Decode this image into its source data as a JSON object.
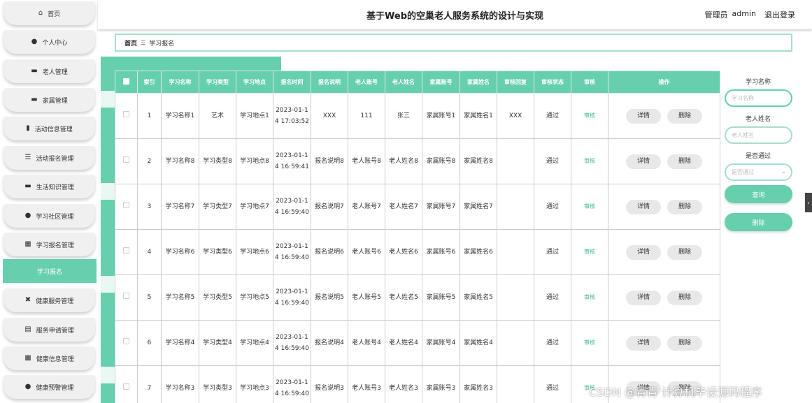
{
  "sidebar": {
    "items": [
      {
        "label": "首页",
        "icon": "home-icon"
      },
      {
        "label": "个人中心",
        "icon": "user-icon"
      },
      {
        "label": "老人管理",
        "icon": "monitor-icon"
      },
      {
        "label": "家属管理",
        "icon": "monitor-icon"
      },
      {
        "label": "活动信息管理",
        "icon": "chart-icon"
      },
      {
        "label": "活动报名管理",
        "icon": "list-icon"
      },
      {
        "label": "生活知识管理",
        "icon": "monitor-icon"
      },
      {
        "label": "学习社区管理",
        "icon": "user-icon"
      },
      {
        "label": "学习报名管理",
        "icon": "grid-icon"
      },
      {
        "label": "健康服务管理",
        "icon": "ticket-icon"
      },
      {
        "label": "服务申请管理",
        "icon": "document-icon"
      },
      {
        "label": "健康信息管理",
        "icon": "grid-icon"
      },
      {
        "label": "健康预警管理",
        "icon": "user-icon"
      }
    ],
    "active_sub": "学习报名"
  },
  "header": {
    "title": "基于Web的空巢老人服务系统的设计与实现",
    "role": "管理员",
    "username": "admin",
    "logout": "退出登录"
  },
  "breadcrumb": {
    "home": "首页",
    "separator": "☰",
    "current": "学习报名"
  },
  "table": {
    "columns": [
      "索引",
      "学习名称",
      "学习类型",
      "学习地点",
      "报名时间",
      "报名说明",
      "老人账号",
      "老人姓名",
      "家属账号",
      "家属姓名",
      "审核回复",
      "审核状态",
      "审核",
      "操作"
    ],
    "rows": [
      {
        "index": "1",
        "name": "学习名称1",
        "type": "艺术",
        "place": "学习地点1",
        "time": "2023-01-14 17:03:52",
        "desc": "XXX",
        "elder_account": "111",
        "elder_name": "张三",
        "family_account": "家属账号1",
        "family_name": "家属姓名1",
        "reply": "XXX",
        "status": "通过",
        "audit": "审核",
        "detail": "详情",
        "delete": "删除"
      },
      {
        "index": "2",
        "name": "学习名称8",
        "type": "学习类型8",
        "place": "学习地点8",
        "time": "2023-01-14 16:59:41",
        "desc": "报名说明8",
        "elder_account": "老人账号8",
        "elder_name": "老人姓名8",
        "family_account": "家属账号8",
        "family_name": "家属姓名8",
        "reply": "",
        "status": "通过",
        "audit": "审核",
        "detail": "详情",
        "delete": "删除"
      },
      {
        "index": "3",
        "name": "学习名称7",
        "type": "学习类型7",
        "place": "学习地点7",
        "time": "2023-01-14 16:59:40",
        "desc": "报名说明7",
        "elder_account": "老人账号7",
        "elder_name": "老人姓名7",
        "family_account": "家属账号7",
        "family_name": "家属姓名7",
        "reply": "",
        "status": "通过",
        "audit": "审核",
        "detail": "详情",
        "delete": "删除"
      },
      {
        "index": "4",
        "name": "学习名称6",
        "type": "学习类型6",
        "place": "学习地点6",
        "time": "2023-01-14 16:59:40",
        "desc": "报名说明6",
        "elder_account": "老人账号6",
        "elder_name": "老人姓名6",
        "family_account": "家属账号6",
        "family_name": "家属姓名6",
        "reply": "",
        "status": "通过",
        "audit": "审核",
        "detail": "详情",
        "delete": "删除"
      },
      {
        "index": "5",
        "name": "学习名称5",
        "type": "学习类型5",
        "place": "学习地点5",
        "time": "2023-01-14 16:59:40",
        "desc": "报名说明5",
        "elder_account": "老人账号5",
        "elder_name": "老人姓名5",
        "family_account": "家属账号5",
        "family_name": "家属姓名5",
        "reply": "",
        "status": "通过",
        "audit": "审核",
        "detail": "详情",
        "delete": "删除"
      },
      {
        "index": "6",
        "name": "学习名称4",
        "type": "学习类型4",
        "place": "学习地点4",
        "time": "2023-01-14 16:59:40",
        "desc": "报名说明4",
        "elder_account": "老人账号4",
        "elder_name": "老人姓名4",
        "family_account": "家属账号4",
        "family_name": "家属姓名4",
        "reply": "",
        "status": "通过",
        "audit": "审核",
        "detail": "详情",
        "delete": "删除"
      },
      {
        "index": "7",
        "name": "学习名称3",
        "type": "学习类型3",
        "place": "学习地点3",
        "time": "2023-01-14 16:59:40",
        "desc": "报名说明3",
        "elder_account": "老人账号3",
        "elder_name": "老人姓名3",
        "family_account": "家属账号3",
        "family_name": "家属姓名3",
        "reply": "",
        "status": "通过",
        "audit": "审核",
        "detail": "详情",
        "delete": "删除"
      }
    ]
  },
  "search": {
    "name_label": "学习名称",
    "name_placeholder": "学习名称",
    "elder_label": "老人姓名",
    "elder_placeholder": "老人姓名",
    "pass_label": "是否通过",
    "pass_placeholder": "是否通过",
    "query_button": "查询",
    "delete_button": "删除"
  },
  "watermark": "CSDN @青青  计算机毕设源码程序",
  "colors": {
    "accent": "#66cfae",
    "border": "#a6ddd0"
  }
}
